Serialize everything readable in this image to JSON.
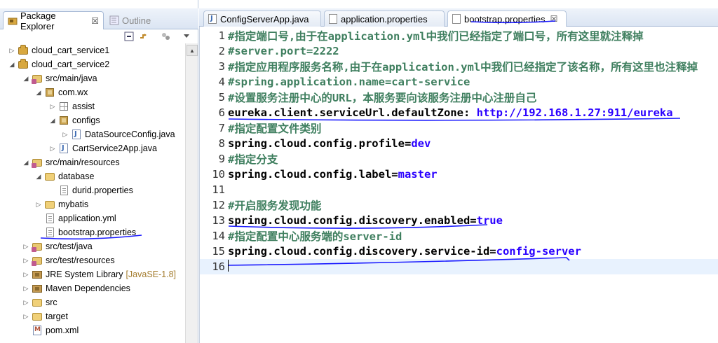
{
  "left_tabs": {
    "package_explorer": "Package Explorer",
    "outline": "Outline",
    "close_glyph": "☒"
  },
  "tree": [
    {
      "label": "cloud_cart_service1",
      "icon": "project-icon",
      "expanded": false
    },
    {
      "label": "cloud_cart_service2",
      "icon": "project-icon",
      "expanded": true
    },
    {
      "label": "src/main/java",
      "icon": "source-folder-icon",
      "expanded": true
    },
    {
      "label": "com.wx",
      "icon": "package-icon",
      "expanded": true
    },
    {
      "label": "assist",
      "icon": "empty-package-icon",
      "expanded": false
    },
    {
      "label": "configs",
      "icon": "package-icon",
      "expanded": true
    },
    {
      "label": "DataSourceConfig.java",
      "icon": "java-file-icon",
      "expanded": false
    },
    {
      "label": "CartService2App.java",
      "icon": "java-file-icon",
      "expanded": false
    },
    {
      "label": "src/main/resources",
      "icon": "source-folder-icon",
      "expanded": true
    },
    {
      "label": "database",
      "icon": "folder-icon",
      "expanded": true
    },
    {
      "label": "durid.properties",
      "icon": "file-icon",
      "expanded": false
    },
    {
      "label": "mybatis",
      "icon": "folder-icon",
      "expanded": false
    },
    {
      "label": "application.yml",
      "icon": "file-icon",
      "expanded": false
    },
    {
      "label": "bootstrap.properties",
      "icon": "file-icon",
      "expanded": false
    },
    {
      "label": "src/test/java",
      "icon": "source-folder-icon",
      "expanded": false
    },
    {
      "label": "src/test/resources",
      "icon": "source-folder-icon",
      "expanded": false
    },
    {
      "label": "JRE System Library",
      "suffix": "[JavaSE-1.8]",
      "icon": "library-icon",
      "expanded": false
    },
    {
      "label": "Maven Dependencies",
      "icon": "library-icon",
      "expanded": false
    },
    {
      "label": "src",
      "icon": "folder-icon",
      "expanded": false
    },
    {
      "label": "target",
      "icon": "folder-icon",
      "expanded": false
    },
    {
      "label": "pom.xml",
      "icon": "maven-xml-icon",
      "expanded": false
    }
  ],
  "editor_tabs": [
    {
      "label": "ConfigServerApp.java",
      "icon": "java-file-icon",
      "active": false
    },
    {
      "label": "application.properties",
      "icon": "properties-file-icon",
      "active": false
    },
    {
      "label": "bootstrap.properties",
      "icon": "properties-file-icon",
      "active": true
    }
  ],
  "code_lines": [
    {
      "num": "1",
      "comment": "#指定端口号,由于在application.yml中我们已经指定了端口号，所有这里就注释掉"
    },
    {
      "num": "2",
      "comment": "#server.port=2222"
    },
    {
      "num": "3",
      "comment": "#指定应用程序服务名称,由于在application.yml中我们已经指定了该名称，所有这里也注释掉"
    },
    {
      "num": "4",
      "comment": "#spring.application.name=cart-service"
    },
    {
      "num": "5",
      "comment": "#设置服务注册中心的URL，本服务要向该服务注册中心注册自己"
    },
    {
      "num": "6",
      "key": "eureka.client.serviceUrl.defaultZone",
      "sep": ": ",
      "value": "http://192.168.1.27:911/eureka"
    },
    {
      "num": "7",
      "comment": "#指定配置文件类别"
    },
    {
      "num": "8",
      "key": "spring.cloud.config.profile",
      "sep": "=",
      "value": "dev"
    },
    {
      "num": "9",
      "comment": "#指定分支"
    },
    {
      "num": "10",
      "key": "spring.cloud.config.label",
      "sep": "=",
      "value": "master"
    },
    {
      "num": "11"
    },
    {
      "num": "12",
      "comment": "#开启服务发现功能"
    },
    {
      "num": "13",
      "key": "spring.cloud.config.discovery.enabled",
      "sep": "=",
      "value": "true"
    },
    {
      "num": "14",
      "comment": "#指定配置中心服务端的server-id"
    },
    {
      "num": "15",
      "key": "spring.cloud.config.discovery.service-id",
      "sep": "=",
      "value": "config-server"
    },
    {
      "num": "16"
    }
  ],
  "colors": {
    "comment": "#3f7f5f",
    "value": "#2a00ff",
    "annotation": "#1a1aff",
    "current_line": "#e8f2fe"
  }
}
